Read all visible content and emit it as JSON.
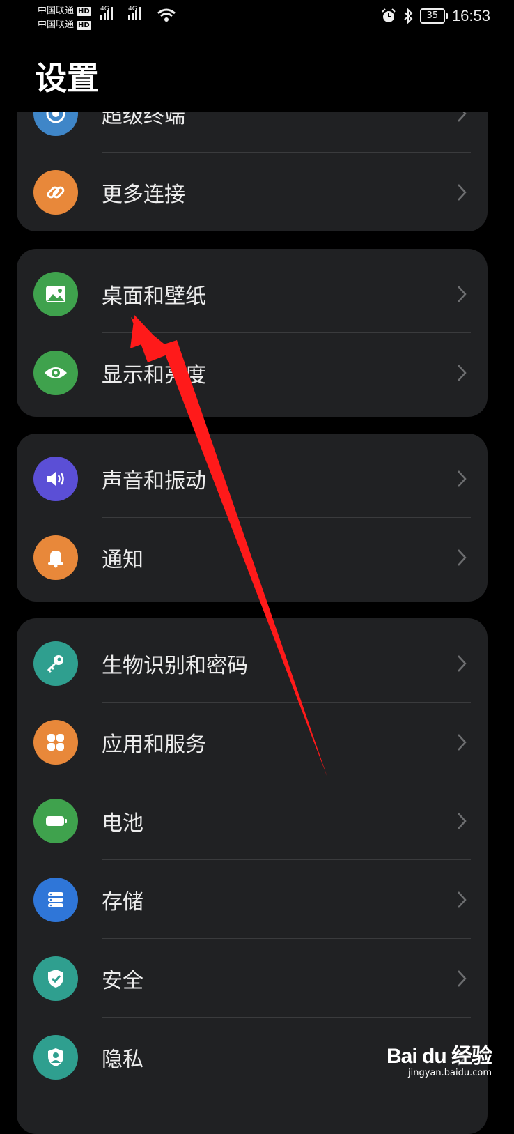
{
  "status_bar": {
    "carrier1": "中国联通",
    "carrier2": "中国联通",
    "hd_badge": "HD",
    "network_label": "4G",
    "battery": "35",
    "time": "16:53"
  },
  "page": {
    "title": "设置"
  },
  "groups": [
    {
      "items": [
        {
          "label": "超级终端",
          "icon": "super-device-icon",
          "color": "#3f86c8"
        },
        {
          "label": "更多连接",
          "icon": "link-icon",
          "color": "#e8883a"
        }
      ]
    },
    {
      "items": [
        {
          "label": "桌面和壁纸",
          "icon": "image-icon",
          "color": "#3fa24d"
        },
        {
          "label": "显示和亮度",
          "icon": "eye-icon",
          "color": "#3fa24d"
        }
      ]
    },
    {
      "items": [
        {
          "label": "声音和振动",
          "icon": "speaker-icon",
          "color": "#5b4fd6"
        },
        {
          "label": "通知",
          "icon": "bell-icon",
          "color": "#e8883a"
        }
      ]
    },
    {
      "items": [
        {
          "label": "生物识别和密码",
          "icon": "key-icon",
          "color": "#2f9f8f"
        },
        {
          "label": "应用和服务",
          "icon": "apps-icon",
          "color": "#e8883a"
        },
        {
          "label": "电池",
          "icon": "battery-icon",
          "color": "#3fa24d"
        },
        {
          "label": "存储",
          "icon": "storage-icon",
          "color": "#2f76d8"
        },
        {
          "label": "安全",
          "icon": "shield-icon",
          "color": "#2f9f8f"
        },
        {
          "label": "隐私",
          "icon": "privacy-icon",
          "color": "#2f9f8f"
        }
      ]
    }
  ],
  "watermark": {
    "brand": "Bai du 经验",
    "url": "jingyan.baidu.com"
  },
  "annotation": {
    "arrow_color": "#ff1a1a"
  }
}
